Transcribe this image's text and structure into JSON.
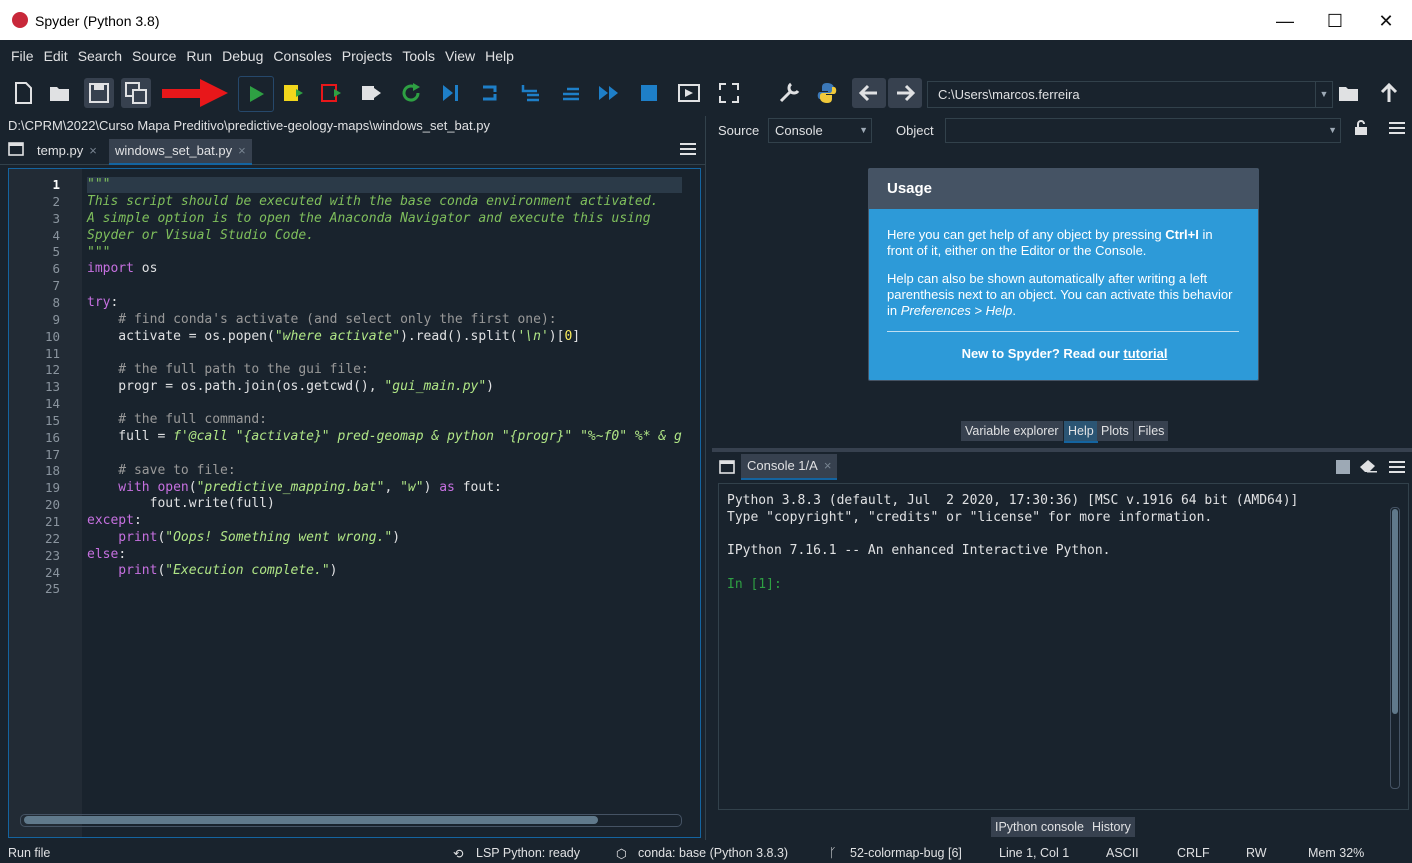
{
  "window": {
    "title": "Spyder (Python 3.8)",
    "minimize": "—",
    "maximize": "☐",
    "close": "✕"
  },
  "menu": [
    "File",
    "Edit",
    "Search",
    "Source",
    "Run",
    "Debug",
    "Consoles",
    "Projects",
    "Tools",
    "View",
    "Help"
  ],
  "toolbar": {
    "working_dir": "C:\\Users\\marcos.ferreira"
  },
  "editor": {
    "filepath": "D:\\CPRM\\2022\\Curso Mapa Preditivo\\predictive-geology-maps\\windows_set_bat.py",
    "tabs": [
      {
        "label": "temp.py",
        "close": "×"
      },
      {
        "label": "windows_set_bat.py",
        "close": "×"
      }
    ],
    "line_numbers": [
      "1",
      "2",
      "3",
      "4",
      "5",
      "6",
      "7",
      "8",
      "9",
      "10",
      "11",
      "12",
      "13",
      "14",
      "15",
      "16",
      "17",
      "18",
      "19",
      "20",
      "21",
      "22",
      "23",
      "24",
      "25"
    ],
    "lines": {
      "l1": "\"\"\"",
      "l2": "This script should be executed with the base conda environment activated.",
      "l3": "A simple option is to open the Anaconda Navigator and execute this using",
      "l4": "Spyder or Visual Studio Code.",
      "l5": "\"\"\"",
      "l6_kw": "import",
      "l6_rest": " os",
      "l8_kw": "try",
      "l8_rest": ":",
      "l9": "    # find conda's activate (and select only the first one):",
      "l10_a": "    activate = os.popen(",
      "l10_s": "\"where activate\"",
      "l10_b": ").read().split(",
      "l10_s2": "'\\n'",
      "l10_c": ")[",
      "l10_n": "0",
      "l10_d": "]",
      "l12": "    # the full path to the gui file:",
      "l13_a": "    progr = os.path.join(os.getcwd(), ",
      "l13_s": "\"gui_main.py\"",
      "l13_b": ")",
      "l15": "    # the full command:",
      "l16_a": "    full = ",
      "l16_s": "f'@call \"{activate}\" pred-geomap & python \"{progr}\" \"%~f0\" %* & g",
      "l18": "    # save to file:",
      "l19_kw": "    with",
      "l19_a": " ",
      "l19_kw2": "open",
      "l19_b": "(",
      "l19_s": "\"predictive_mapping.bat\"",
      "l19_c": ", ",
      "l19_s2": "\"w\"",
      "l19_d": ") ",
      "l19_kw3": "as",
      "l19_e": " fout:",
      "l20": "        fout.write(full)",
      "l21_kw": "except",
      "l21_rest": ":",
      "l22_kw": "    print",
      "l22_a": "(",
      "l22_s": "\"Oops! Something went wrong.\"",
      "l22_b": ")",
      "l23_kw": "else",
      "l23_rest": ":",
      "l24_kw": "    print",
      "l24_a": "(",
      "l24_s": "\"Execution complete.\"",
      "l24_b": ")"
    }
  },
  "help": {
    "source_label": "Source",
    "source_value": "Console",
    "object_label": "Object",
    "usage_title": "Usage",
    "p1_a": "Here you can get help of any object by pressing ",
    "p1_b": "Ctrl+I",
    "p1_c": " in front of it, either on the Editor or the Console.",
    "p2_a": "Help can also be shown automatically after writing a left parenthesis next to an object. You can activate this behavior in ",
    "p2_b": "Preferences > Help",
    "p2_c": ".",
    "new_a": "New to Spyder? Read our ",
    "new_link": "tutorial",
    "tabs": [
      "Variable explorer",
      "Help",
      "Plots",
      "Files"
    ]
  },
  "console": {
    "tab": "Console 1/A",
    "tab_close": "×",
    "lines": [
      "Python 3.8.3 (default, Jul  2 2020, 17:30:36) [MSC v.1916 64 bit (AMD64)]",
      "Type \"copyright\", \"credits\" or \"license\" for more information.",
      "IPython 7.16.1 -- An enhanced Interactive Python."
    ],
    "prompt": "In [1]:",
    "bottom_tabs": [
      "IPython console",
      "History"
    ]
  },
  "status": {
    "left": "Run file",
    "lsp": "LSP Python: ready",
    "conda": "conda: base (Python 3.8.3)",
    "git": "52-colormap-bug [6]",
    "cursor": "Line 1, Col 1",
    "encoding": "ASCII",
    "eol": "CRLF",
    "perm": "RW",
    "mem": "Mem 32%"
  }
}
